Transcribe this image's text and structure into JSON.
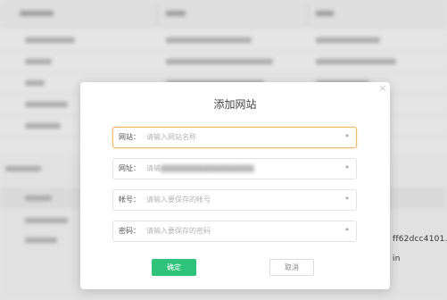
{
  "background": {
    "peek_texts": [
      "ff62dcc4101...",
      "in"
    ]
  },
  "modal": {
    "title": "添加网站",
    "close_glyph": "×",
    "fields": [
      {
        "label": "网站：",
        "placeholder": "请输入网站名称",
        "required_mark": "*"
      },
      {
        "label": "网址：",
        "placeholder": "请输",
        "required_mark": "*"
      },
      {
        "label": "帐号：",
        "placeholder": "请输入要保存的帐号",
        "required_mark": "*"
      },
      {
        "label": "密码：",
        "placeholder": "请输入要保存的密码",
        "required_mark": "*"
      }
    ],
    "confirm_label": "确定",
    "cancel_label": "取消"
  },
  "colors": {
    "confirm_button": "#2fc27a",
    "active_field_border": "#f2b968"
  }
}
